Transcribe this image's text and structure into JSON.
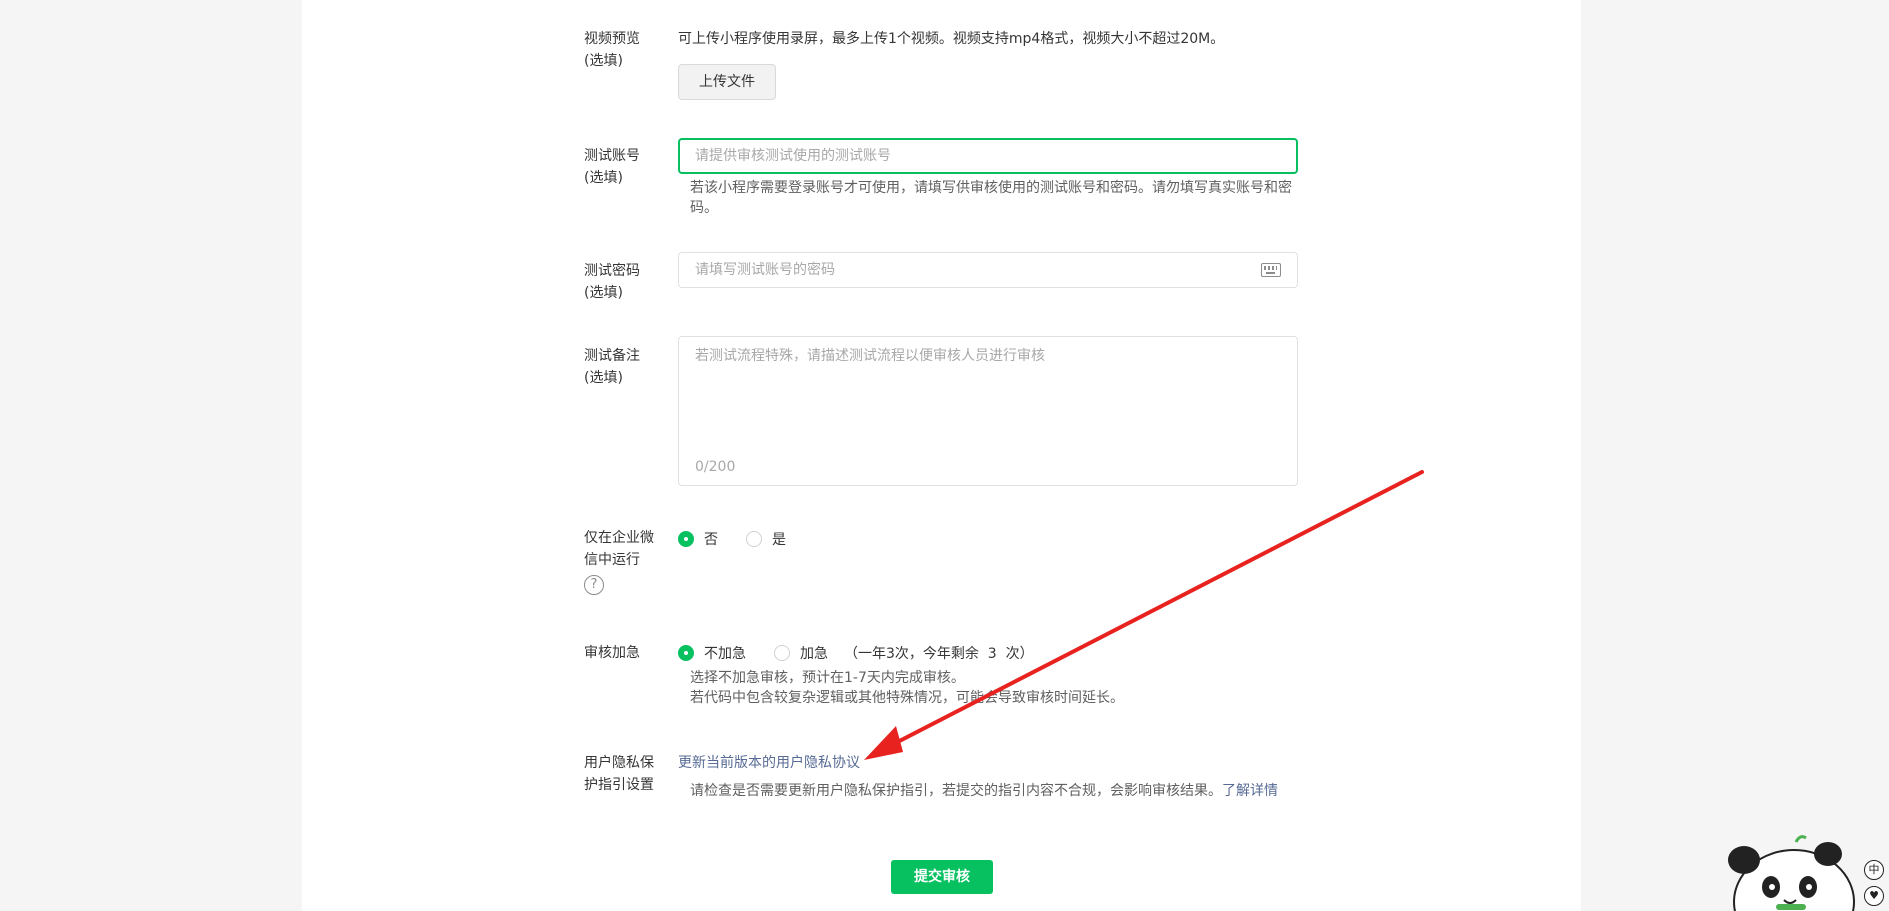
{
  "video_preview": {
    "label": "视频预览\n(选填)",
    "hint": "可上传小程序使用录屏，最多上传1个视频。视频支持mp4格式，视频大小不超过20M。",
    "upload_button": "上传文件"
  },
  "test_account": {
    "label": "测试账号\n(选填)",
    "placeholder": "请提供审核测试使用的测试账号",
    "hint": "若该小程序需要登录账号才可使用，请填写供审核使用的测试账号和密码。请勿填写真实账号和密码。"
  },
  "test_password": {
    "label": "测试密码\n(选填)",
    "placeholder": "请填写测试账号的密码",
    "icon": "keyboard-icon"
  },
  "test_notes": {
    "label": "测试备注\n(选填)",
    "placeholder": "若测试流程特殊，请描述测试流程以便审核人员进行审核",
    "counter": "0/200"
  },
  "wecom_only": {
    "label": "仅在企业微信中运行",
    "help_icon": "?",
    "options": [
      "否",
      "是"
    ],
    "selected": "否"
  },
  "review_speed": {
    "label": "审核加急",
    "options": [
      "不加急",
      "加急"
    ],
    "selected": "不加急",
    "quota": "（一年3次，今年剩余  3  次）",
    "hint_line1": "选择不加急审核，预计在1-7天内完成审核。",
    "hint_line2": "若代码中包含较复杂逻辑或其他特殊情况，可能会导致审核时间延长。"
  },
  "privacy": {
    "label": "用户隐私保护指引设置",
    "link": "更新当前版本的用户隐私协议",
    "hint": "请检查是否需要更新用户隐私保护指引，若提交的指引内容不合规，会影响审核结果。",
    "details_link": "了解详情"
  },
  "submit_label": "提交审核",
  "ime_badges": [
    "中",
    "♥"
  ],
  "colors": {
    "primary": "#07c160",
    "link": "#576b95",
    "arrow": "#e8231f"
  }
}
